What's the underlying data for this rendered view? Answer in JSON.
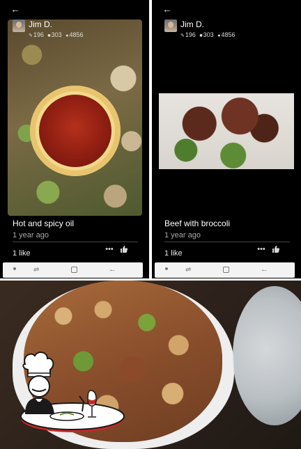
{
  "left_post": {
    "username": "Jim D.",
    "stats": {
      "reviews": "196",
      "photos": "303",
      "points": "4856"
    },
    "title": "Hot and spicy oil",
    "time": "1 year ago",
    "likes": "1 like"
  },
  "right_post": {
    "username": "Jim D.",
    "stats": {
      "reviews": "196",
      "photos": "303",
      "points": "4856"
    },
    "title": "Beef with broccoli",
    "time": "1 year ago",
    "likes": "1 like"
  },
  "icons": {
    "back": "arrow-left",
    "more": "ellipsis",
    "like": "thumbs-up",
    "nav": [
      "dot",
      "recent-apps",
      "home-square",
      "back-arrow"
    ]
  },
  "colors": {
    "panel_bg": "#000000",
    "nav_bg": "#f3f3f3",
    "logo_red": "#c62828"
  }
}
